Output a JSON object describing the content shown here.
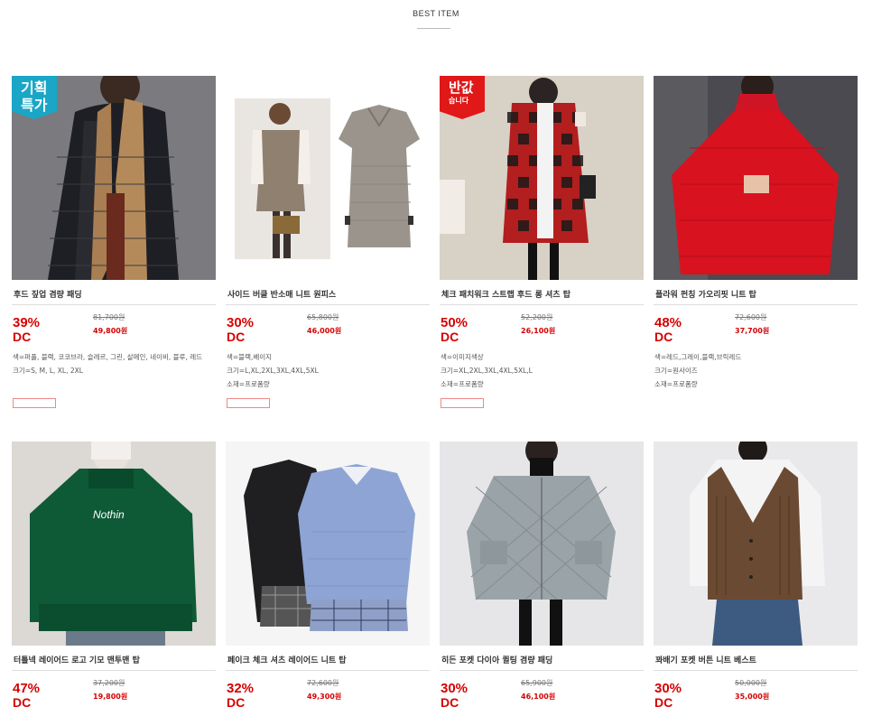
{
  "header": {
    "title": "BEST ITEM"
  },
  "products": [
    {
      "name": "후드 짚업 겸량 패딩",
      "discount": "39%",
      "dc": "DC",
      "original_price": "81,700원",
      "sale_price": "49,800원",
      "details": [
        "색=퍼플, 블랙, 코코브라, 슬레르, 그린, 살메인, 네이비, 블루, 레드",
        "크기=S, M, L, XL, 2XL"
      ],
      "badge": [
        "기획",
        "특가"
      ],
      "badge_color": "#1aa6c7",
      "has_tag": true
    },
    {
      "name": "사이드 버클 반소매 니트 원피스",
      "discount": "30%",
      "dc": "DC",
      "original_price": "65,800원",
      "sale_price": "46,000원",
      "details": [
        "색=블랙,베이지",
        "크기=L,XL,2XL,3XL,4XL,5XL",
        "소재=프로폼량"
      ],
      "badge": [],
      "has_tag": true
    },
    {
      "name": "체크 패치워크 스트랩 후드 롱 셔츠 탑",
      "discount": "50%",
      "dc": "DC",
      "original_price": "52,200원",
      "sale_price": "26,100원",
      "details": [
        "색=이미지색상",
        "크기=XL,2XL,3XL,4XL,5XL,L",
        "소재=프로폼량"
      ],
      "badge": [
        "반값",
        "습니다"
      ],
      "badge_color": "#e01818",
      "has_tag": true
    },
    {
      "name": "플라워 펀칭 가오리핏 니트 탑",
      "discount": "48%",
      "dc": "DC",
      "original_price": "72,600원",
      "sale_price": "37,700원",
      "details": [
        "색=레드,그레이,블랙,브릭레드",
        "크기=원사이즈",
        "소재=프로폼량"
      ],
      "badge": [],
      "has_tag": false
    },
    {
      "name": "터틀넥 레이어드 로고 기모 맨투맨 탑",
      "discount": "47%",
      "dc": "DC",
      "original_price": "37,200원",
      "sale_price": "19,800원",
      "details": [],
      "badge": [],
      "has_tag": false
    },
    {
      "name": "페이크 체크 셔츠 레이어드 니트 탑",
      "discount": "32%",
      "dc": "DC",
      "original_price": "72,600원",
      "sale_price": "49,300원",
      "details": [],
      "badge": [],
      "has_tag": false
    },
    {
      "name": "히든 포켓 다이아 퀼팅 겸량 패딩",
      "discount": "30%",
      "dc": "DC",
      "original_price": "65,900원",
      "sale_price": "46,100원",
      "details": [],
      "badge": [],
      "has_tag": false
    },
    {
      "name": "꽈배기 포켓 버튼 니트 베스트",
      "discount": "30%",
      "dc": "DC",
      "original_price": "50,000원",
      "sale_price": "35,000원",
      "details": [],
      "badge": [],
      "has_tag": false
    }
  ]
}
